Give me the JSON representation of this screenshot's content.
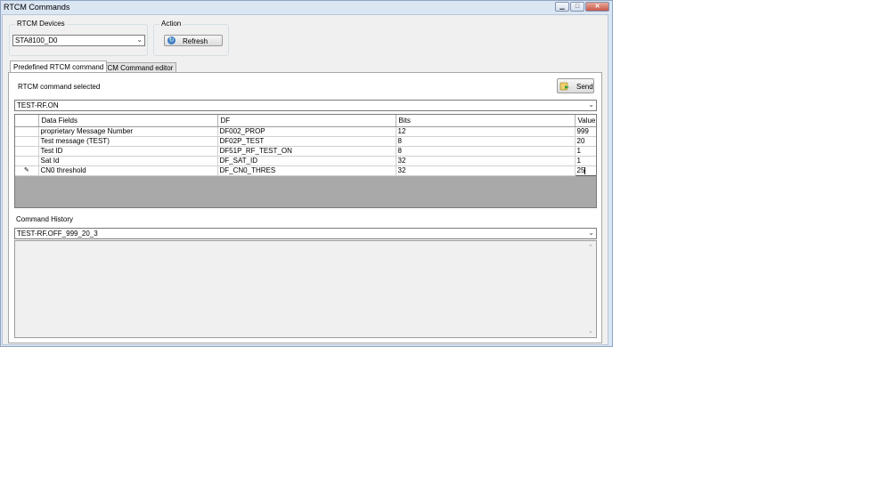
{
  "window": {
    "title": "RTCM Commands"
  },
  "devices": {
    "label": "RTCM Devices",
    "selected": "STA8100_D0"
  },
  "action": {
    "label": "Action",
    "refresh_label": "Refresh"
  },
  "tabs": [
    {
      "label": "Predefined RTCM command",
      "active": true
    },
    {
      "label": "RTCM Command editor",
      "active": false
    }
  ],
  "command": {
    "selected_label": "RTCM command selected",
    "send_label": "Send",
    "selected_value": "TEST-RF.ON"
  },
  "grid": {
    "headers": [
      "Data Fields",
      "DF",
      "Bits",
      "Value"
    ],
    "rows": [
      [
        "proprietary Message Number",
        "DF002_PROP",
        "12",
        "999"
      ],
      [
        "Test message (TEST)",
        "DF02P_TEST",
        "8",
        "20"
      ],
      [
        "Test ID",
        "DF51P_RF_TEST_ON",
        "8",
        "1"
      ],
      [
        "Sat Id",
        "DF_SAT_ID",
        "32",
        "1"
      ],
      [
        "CN0 threshold",
        "DF_CN0_THRES",
        "32",
        "25"
      ]
    ],
    "editing_row_indicator": "✎"
  },
  "history": {
    "label": "Command History",
    "selected": "TEST-RF.OFF_999_20_3"
  },
  "colors": {
    "title_bar": "#dbe6f3",
    "close_button": "#c7574a",
    "grid_empty": "#a9a9a9"
  }
}
